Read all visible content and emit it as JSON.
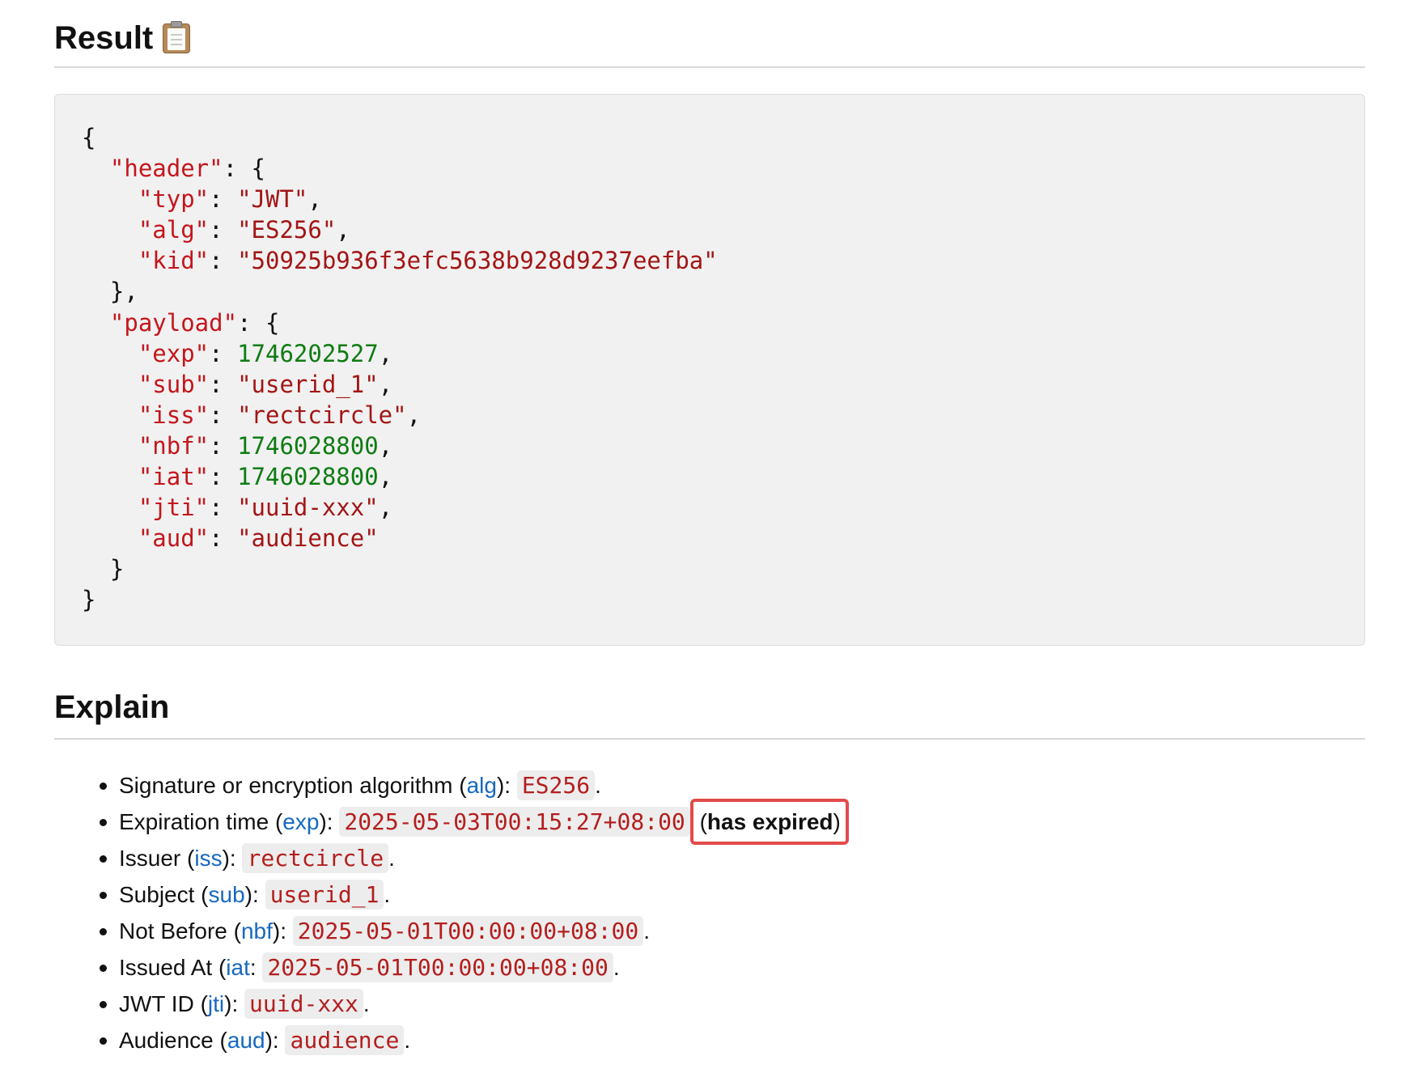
{
  "result": {
    "title": "Result",
    "icon": "clipboard-icon",
    "code": {
      "open_brace": "{",
      "header_key": "\"header\"",
      "header_items": [
        {
          "key": "\"typ\"",
          "value": "\"JWT\"",
          "type": "string"
        },
        {
          "key": "\"alg\"",
          "value": "\"ES256\"",
          "type": "string"
        },
        {
          "key": "\"kid\"",
          "value": "\"50925b936f3efc5638b928d9237eefba\"",
          "type": "string"
        }
      ],
      "payload_key": "\"payload\"",
      "payload_items": [
        {
          "key": "\"exp\"",
          "value": "1746202527",
          "type": "number"
        },
        {
          "key": "\"sub\"",
          "value": "\"userid_1\"",
          "type": "string"
        },
        {
          "key": "\"iss\"",
          "value": "\"rectcircle\"",
          "type": "string"
        },
        {
          "key": "\"nbf\"",
          "value": "1746028800",
          "type": "number"
        },
        {
          "key": "\"iat\"",
          "value": "1746028800",
          "type": "number"
        },
        {
          "key": "\"jti\"",
          "value": "\"uuid-xxx\"",
          "type": "string"
        },
        {
          "key": "\"aud\"",
          "value": "\"audience\"",
          "type": "string"
        }
      ],
      "close_brace": "}"
    }
  },
  "explain": {
    "title": "Explain",
    "items": [
      {
        "label": "Signature or encryption algorithm",
        "field": "alg",
        "value": "ES256"
      },
      {
        "label": "Expiration time",
        "field": "exp",
        "value": "2025-05-03T00:15:27+08:00",
        "note": "has expired"
      },
      {
        "label": "Issuer",
        "field": "iss",
        "value": "rectcircle"
      },
      {
        "label": "Subject",
        "field": "sub",
        "value": "userid_1"
      },
      {
        "label": "Not Before",
        "field": "nbf",
        "value": "2025-05-01T00:00:00+08:00"
      },
      {
        "label": "Issued At",
        "field": "iat",
        "value": "2025-05-01T00:00:00+08:00"
      },
      {
        "label": "JWT ID",
        "field": "jti",
        "value": "uuid-xxx"
      },
      {
        "label": "Audience",
        "field": "aud",
        "value": "audience"
      }
    ]
  },
  "colors": {
    "json_key": "#c4161c",
    "json_string": "#a31515",
    "json_number": "#0e7c12",
    "field_link": "#1668c1",
    "highlight_box": "#e24b4b",
    "code_background": "#f1f1f1"
  }
}
